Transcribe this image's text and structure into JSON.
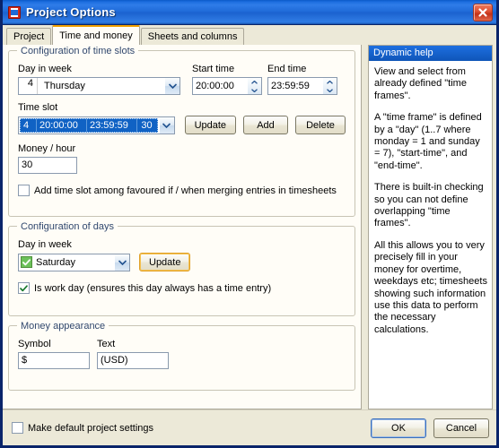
{
  "window": {
    "title": "Project Options",
    "icon": "application-icon",
    "close_label": "✕"
  },
  "tabs": [
    {
      "label": "Project",
      "active": false
    },
    {
      "label": "Time and money",
      "active": true
    },
    {
      "label": "Sheets and columns",
      "active": false
    }
  ],
  "time_slots_group": {
    "title": "Configuration of time slots",
    "day_label": "Day in week",
    "day_number": "4",
    "day_value": "Thursday",
    "start_label": "Start time",
    "start_value": "20:00:00",
    "end_label": "End time",
    "end_value": "23:59:59",
    "slot_label": "Time slot",
    "slot_cells": [
      "4",
      "20:00:00",
      "23:59:59",
      "30"
    ],
    "update_label": "Update",
    "add_label": "Add",
    "delete_label": "Delete",
    "money_hour_label": "Money / hour",
    "money_hour_value": "30",
    "favoured_checkbox_label": "Add time slot among favoured if / when merging entries in timesheets",
    "favoured_checked": false
  },
  "days_group": {
    "title": "Configuration of days",
    "day_label": "Day in week",
    "day_value": "Saturday",
    "day_checked": true,
    "update_label": "Update",
    "workday_checkbox_label": "Is work day (ensures this day always has a time entry)",
    "workday_checked": true
  },
  "money_group": {
    "title": "Money appearance",
    "symbol_label": "Symbol",
    "symbol_value": "$",
    "text_label": "Text",
    "text_value": "(USD)"
  },
  "help": {
    "header": "Dynamic help",
    "paragraphs": [
      "View and select from already defined \"time frames\".",
      "A \"time frame\" is defined by a \"day\" (1..7 where monday = 1 and sunday = 7), \"start-time\", and \"end-time\".",
      "There is built-in checking so you can not define overlapping \"time frames\".",
      "All this allows you to very precisely fill in your money for overtime, weekdays etc; timesheets showing such information use this data to perform the necessary calculations."
    ]
  },
  "footer": {
    "default_checkbox_label": "Make default project settings",
    "default_checked": false,
    "ok_label": "OK",
    "cancel_label": "Cancel"
  },
  "colors": {
    "titlebar_blue": "#1f6ad8",
    "window_border": "#0a246a",
    "dialog_face": "#ece9d8",
    "panel_face": "#fffdf7",
    "group_title": "#31486e",
    "selection_blue": "#1062c4",
    "active_tab_accent": "#f0a000",
    "help_header": "#1560d0",
    "green_check": "#6cc15a",
    "close_red": "#c33218"
  }
}
